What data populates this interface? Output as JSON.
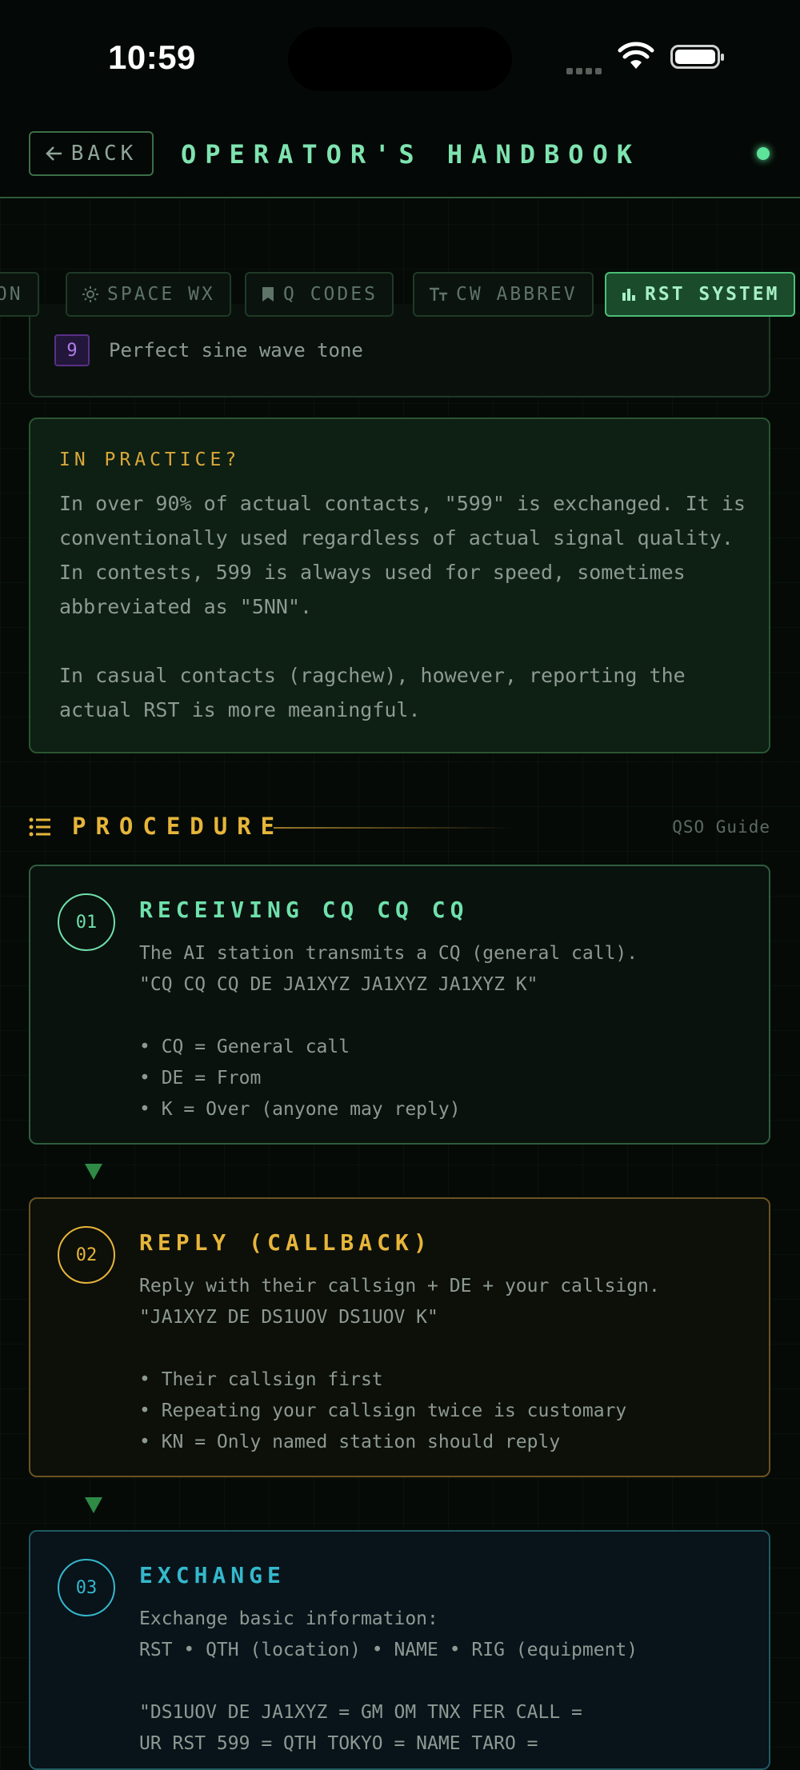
{
  "status": {
    "time": "10:59"
  },
  "header": {
    "back_label": "BACK",
    "title": "OPERATOR'S HANDBOOK"
  },
  "tabs": [
    {
      "label": "ION",
      "icon": "none"
    },
    {
      "label": "SPACE WX",
      "icon": "sun-icon"
    },
    {
      "label": "Q CODES",
      "icon": "bookmark-icon"
    },
    {
      "label": "CW ABBREV",
      "icon": "text-size-icon"
    },
    {
      "label": "RST SYSTEM",
      "icon": "bar-chart-icon",
      "active": true
    }
  ],
  "scale": {
    "number": "9",
    "description": "Perfect sine wave tone"
  },
  "practice": {
    "title": "IN PRACTICE?",
    "paragraph1": "In over 90% of actual contacts, \"599\" is exchanged. It is conventionally used regardless of actual signal quality. In contests, 599 is always used for speed, sometimes abbreviated as \"5NN\".",
    "paragraph2": "In casual contacts (ragchew), however, reporting the actual RST is more meaningful."
  },
  "procedure": {
    "title": "PROCEDURE",
    "subtitle": "QSO Guide"
  },
  "steps": [
    {
      "number": "01",
      "title": "RECEIVING CQ CQ CQ",
      "body": "The AI station transmits a CQ (general call).\n\"CQ CQ CQ DE JA1XYZ JA1XYZ JA1XYZ K\"\n\n• CQ = General call\n• DE = From\n• K = Over (anyone may reply)"
    },
    {
      "number": "02",
      "title": "REPLY (CALLBACK)",
      "body": "Reply with their callsign + DE + your callsign.\n\"JA1XYZ DE DS1UOV DS1UOV K\"\n\n• Their callsign first\n• Repeating your callsign twice is customary\n• KN = Only named station should reply"
    },
    {
      "number": "03",
      "title": "EXCHANGE",
      "body": "Exchange basic information:\nRST • QTH (location) • NAME • RIG (equipment)\n\n\"DS1UOV DE JA1XYZ = GM OM TNX FER CALL =\nUR RST 599 = QTH TOKYO = NAME TARO ="
    }
  ],
  "colors": {
    "accent_green": "#6fe0ac",
    "accent_amber": "#e6b53a",
    "accent_cyan": "#34b8cc",
    "background": "#050a07"
  }
}
